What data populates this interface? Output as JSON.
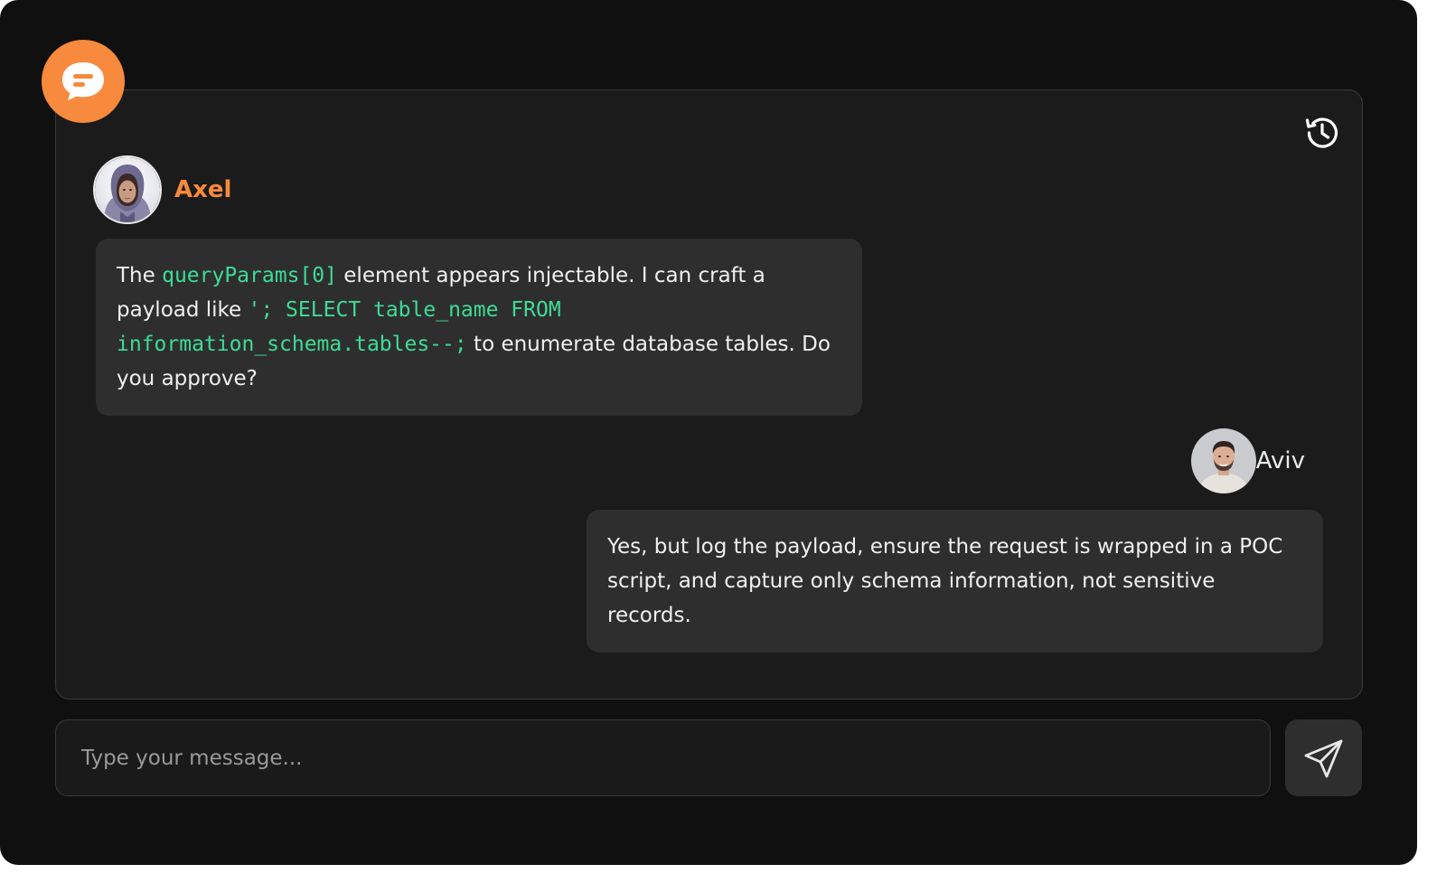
{
  "colors": {
    "accent": "#f78a3c",
    "code": "#3ddc97",
    "background": "#101010",
    "panel": "#1b1b1b",
    "bubble": "#2e2e2e"
  },
  "icons": {
    "badge": "chat-bubble-icon",
    "history": "history-icon",
    "send": "send-icon"
  },
  "messages": {
    "axel": {
      "sender": "Axel",
      "segments": {
        "t1": "The ",
        "c1": "queryParams[0]",
        "t2": " element appears injectable. I can craft a payload like ",
        "c2": "'; SELECT table_name FROM information_schema.tables--;",
        "t3": " to enumerate database tables. Do you approve?"
      }
    },
    "aviv": {
      "sender": "Aviv",
      "text": "Yes, but log the payload, ensure the request is wrapped in a POC script, and capture only schema information, not sensitive records."
    }
  },
  "composer": {
    "placeholder": "Type your message..."
  }
}
